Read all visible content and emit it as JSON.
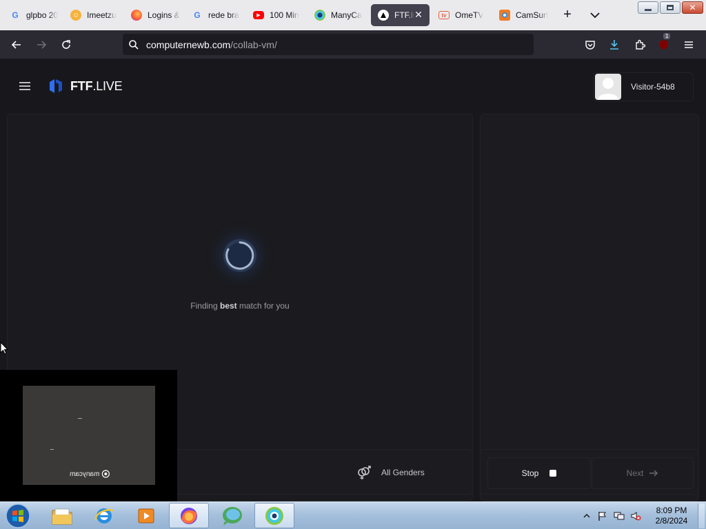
{
  "browser": {
    "tabs": [
      {
        "label": "glpbo 20",
        "icon": "google-icon",
        "active": false
      },
      {
        "label": "Imeetzu",
        "icon": "imeetzu-icon",
        "active": false
      },
      {
        "label": "Logins &",
        "icon": "firefox-icon",
        "active": false
      },
      {
        "label": "rede bra",
        "icon": "google-icon",
        "active": false
      },
      {
        "label": "100 Min",
        "icon": "youtube-icon",
        "active": false
      },
      {
        "label": "ManyCa",
        "icon": "manycam-icon",
        "active": false
      },
      {
        "label": "FTF.li",
        "icon": "ftf-icon",
        "active": true
      },
      {
        "label": "OmeTV",
        "icon": "ometv-icon",
        "active": false
      },
      {
        "label": "CamSurf",
        "icon": "camsurf-icon",
        "active": false
      }
    ],
    "url_host": "computernewb.com",
    "url_path": "/collab-vm/",
    "extension_badge": "1"
  },
  "site": {
    "brand_bold": "FTF",
    "brand_rest": ".LIVE",
    "visitor_name": "Visitor-54b8",
    "status_prefix": "Finding ",
    "status_bold": "best",
    "status_suffix": " match for you",
    "gender_label": "All Genders",
    "stop_label": "Stop",
    "next_label": "Next",
    "watermark": "manycam"
  },
  "taskbar": {
    "time": "8:09 PM",
    "date": "2/8/2024"
  }
}
